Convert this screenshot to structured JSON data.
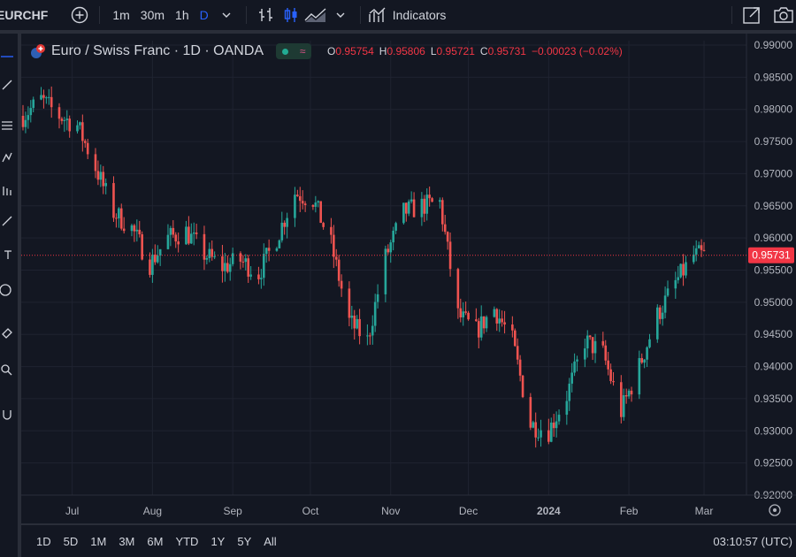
{
  "toolbar": {
    "symbol": "EURCHF",
    "timeframes": [
      "1m",
      "30m",
      "1h",
      "D"
    ],
    "active_timeframe": "D",
    "indicators_label": "Indicators",
    "icons": [
      "add-symbol-icon",
      "bar-style-icon",
      "candles-icon",
      "area-icon",
      "indicators-icon",
      "snapshot-icon",
      "camera-icon"
    ]
  },
  "legend": {
    "title": "Euro / Swiss Franc · 1D · OANDA",
    "o_label": "O",
    "o": "0.95754",
    "h_label": "H",
    "h": "0.95806",
    "l_label": "L",
    "l": "0.95721",
    "c_label": "C",
    "c": "0.95731",
    "change": "−0.00023 (−0.02%)"
  },
  "colors": {
    "up": "#26a69a",
    "down": "#ef5350",
    "background": "#131722",
    "grid": "#1f2330",
    "price_label": "#f23645"
  },
  "range_buttons": [
    "1D",
    "5D",
    "1M",
    "3M",
    "6M",
    "YTD",
    "1Y",
    "5Y",
    "All"
  ],
  "clock": "03:10:57 (UTC)",
  "chart_data": {
    "type": "candlestick",
    "symbol": "EURCHF",
    "title": "Euro / Swiss Franc · 1D · OANDA",
    "y_ticks": [
      "0.99000",
      "0.98500",
      "0.98000",
      "0.97500",
      "0.97000",
      "0.96500",
      "0.96000",
      "0.95500",
      "0.95000",
      "0.94500",
      "0.94000",
      "0.93500",
      "0.93000",
      "0.92500",
      "0.92000"
    ],
    "ylim": [
      0.92,
      0.99
    ],
    "x_ticks": [
      "Jul",
      "Aug",
      "Sep",
      "Oct",
      "Nov",
      "Dec",
      "2024",
      "Feb",
      "Mar"
    ],
    "x_tick_dates": [
      "2023-07-01",
      "2023-08-01",
      "2023-09-01",
      "2023-10-01",
      "2023-11-01",
      "2023-12-01",
      "2024-01-01",
      "2024-02-01",
      "2024-03-01"
    ],
    "last_price": "0.95731",
    "close_series": [
      {
        "date": "2023-06-12",
        "close": 0.979
      },
      {
        "date": "2023-06-19",
        "close": 0.9815
      },
      {
        "date": "2023-06-26",
        "close": 0.979
      },
      {
        "date": "2023-07-03",
        "close": 0.9775
      },
      {
        "date": "2023-07-10",
        "close": 0.971
      },
      {
        "date": "2023-07-17",
        "close": 0.964
      },
      {
        "date": "2023-07-24",
        "close": 0.9615
      },
      {
        "date": "2023-07-31",
        "close": 0.956
      },
      {
        "date": "2023-08-07",
        "close": 0.96
      },
      {
        "date": "2023-08-14",
        "close": 0.961
      },
      {
        "date": "2023-08-21",
        "close": 0.9575
      },
      {
        "date": "2023-08-28",
        "close": 0.9555
      },
      {
        "date": "2023-09-04",
        "close": 0.9565
      },
      {
        "date": "2023-09-11",
        "close": 0.9545
      },
      {
        "date": "2023-09-18",
        "close": 0.96
      },
      {
        "date": "2023-09-25",
        "close": 0.967
      },
      {
        "date": "2023-10-02",
        "close": 0.966
      },
      {
        "date": "2023-10-09",
        "close": 0.959
      },
      {
        "date": "2023-10-16",
        "close": 0.947
      },
      {
        "date": "2023-10-23",
        "close": 0.944
      },
      {
        "date": "2023-10-30",
        "close": 0.957
      },
      {
        "date": "2023-11-06",
        "close": 0.964
      },
      {
        "date": "2023-11-13",
        "close": 0.965
      },
      {
        "date": "2023-11-20",
        "close": 0.9655
      },
      {
        "date": "2023-11-27",
        "close": 0.948
      },
      {
        "date": "2023-12-04",
        "close": 0.9455
      },
      {
        "date": "2023-12-11",
        "close": 0.949
      },
      {
        "date": "2023-12-18",
        "close": 0.944
      },
      {
        "date": "2023-12-25",
        "close": 0.931
      },
      {
        "date": "2024-01-01",
        "close": 0.93
      },
      {
        "date": "2024-01-08",
        "close": 0.9355
      },
      {
        "date": "2024-01-15",
        "close": 0.944
      },
      {
        "date": "2024-01-22",
        "close": 0.942
      },
      {
        "date": "2024-01-29",
        "close": 0.933
      },
      {
        "date": "2024-02-05",
        "close": 0.94
      },
      {
        "date": "2024-02-12",
        "close": 0.948
      },
      {
        "date": "2024-02-19",
        "close": 0.953
      },
      {
        "date": "2024-02-26",
        "close": 0.9573
      }
    ]
  }
}
